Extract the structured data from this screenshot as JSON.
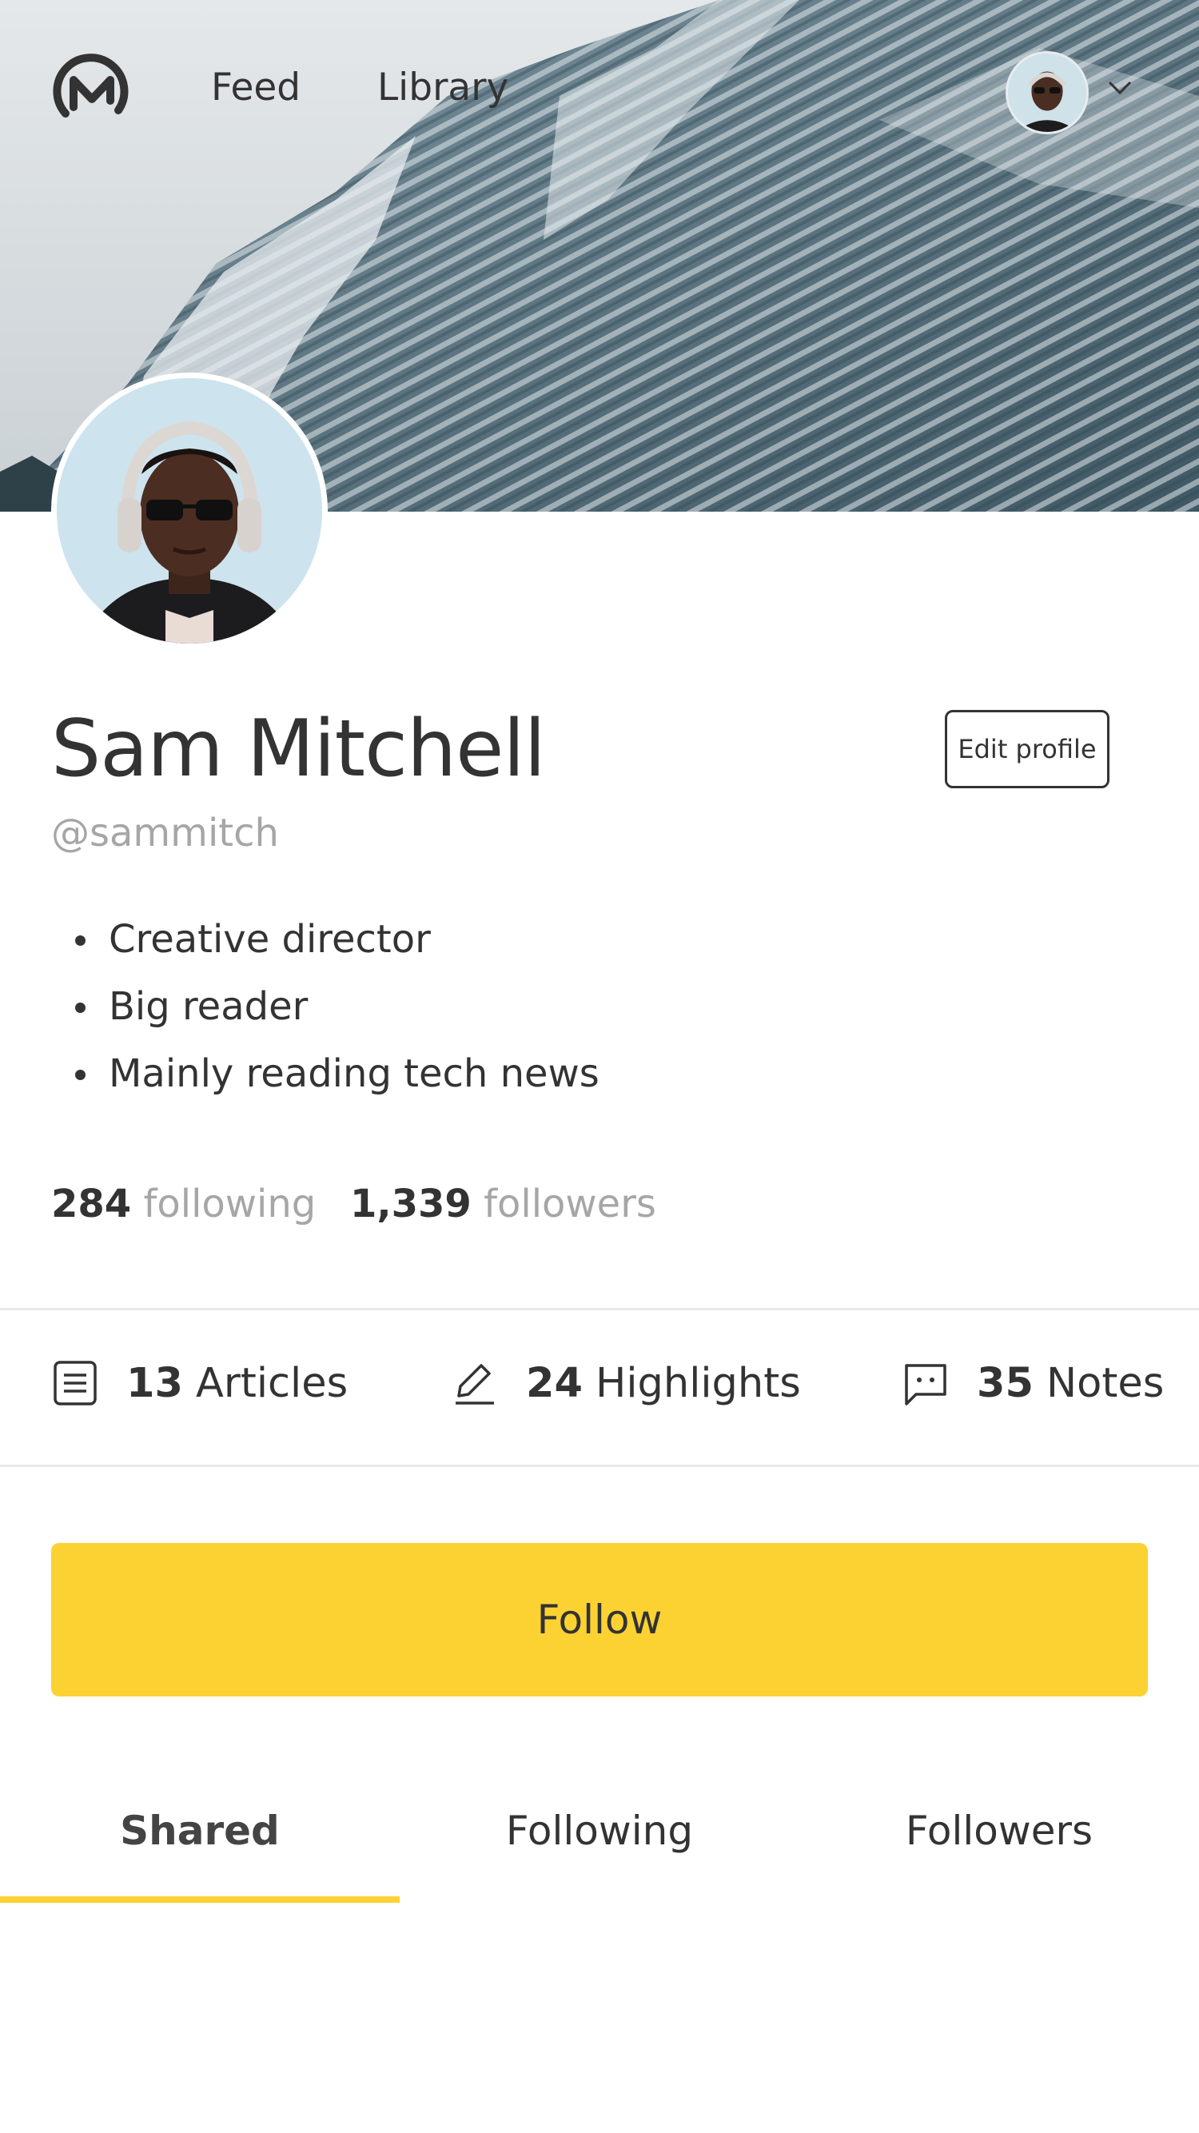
{
  "nav": {
    "logo": "medium-logo-icon",
    "feed_label": "Feed",
    "library_label": "Library",
    "account_menu_icon": "chevron-down-icon"
  },
  "profile": {
    "name": "Sam Mitchell",
    "handle": "@sammitch",
    "edit_label": "Edit profile",
    "bio": [
      "Creative director",
      "Big reader",
      "Mainly reading tech news"
    ],
    "following_count": "284",
    "following_label": "following",
    "followers_count": "1,339",
    "followers_label": "followers"
  },
  "counts": {
    "articles": {
      "value": "13",
      "label": "Articles",
      "icon": "document-icon"
    },
    "highlights": {
      "value": "24",
      "label": "Highlights",
      "icon": "pencil-icon"
    },
    "notes": {
      "value": "35",
      "label": "Notes",
      "icon": "speech-bubble-icon"
    }
  },
  "follow_label": "Follow",
  "tabs": [
    {
      "label": "Shared",
      "active": true
    },
    {
      "label": "Following",
      "active": false
    },
    {
      "label": "Followers",
      "active": false
    }
  ],
  "colors": {
    "accent": "#fcd232",
    "text": "#333333",
    "muted": "#a6a6a6"
  }
}
